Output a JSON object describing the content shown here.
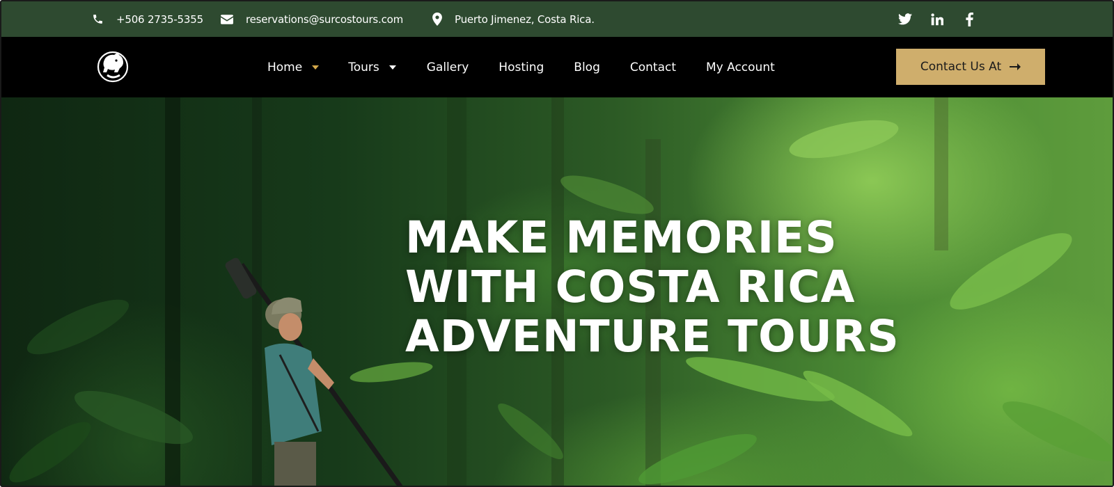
{
  "topbar": {
    "phone": "+506 2735-5355",
    "email": "reservations@surcostours.com",
    "location": "Puerto Jimenez, Costa Rica.",
    "social_icons": [
      "twitter-icon",
      "linkedin-icon",
      "facebook-icon"
    ]
  },
  "nav": {
    "items": [
      {
        "label": "Home",
        "has_dropdown": true,
        "active": true
      },
      {
        "label": "Tours",
        "has_dropdown": true
      },
      {
        "label": "Gallery"
      },
      {
        "label": "Hosting"
      },
      {
        "label": "Blog"
      },
      {
        "label": "Contact"
      },
      {
        "label": "My Account"
      }
    ],
    "cta_label": "Contact Us At",
    "cta_icon": "arrow-right-icon"
  },
  "hero": {
    "title_lines": [
      "MAKE MEMORIES",
      "WITH COSTA RICA",
      "ADVENTURE TOURS"
    ]
  },
  "colors": {
    "topbar_bg": "#2e4a30",
    "nav_bg": "#000000",
    "accent_gold": "#cfae6c",
    "caret_gold": "#d4a84a"
  }
}
